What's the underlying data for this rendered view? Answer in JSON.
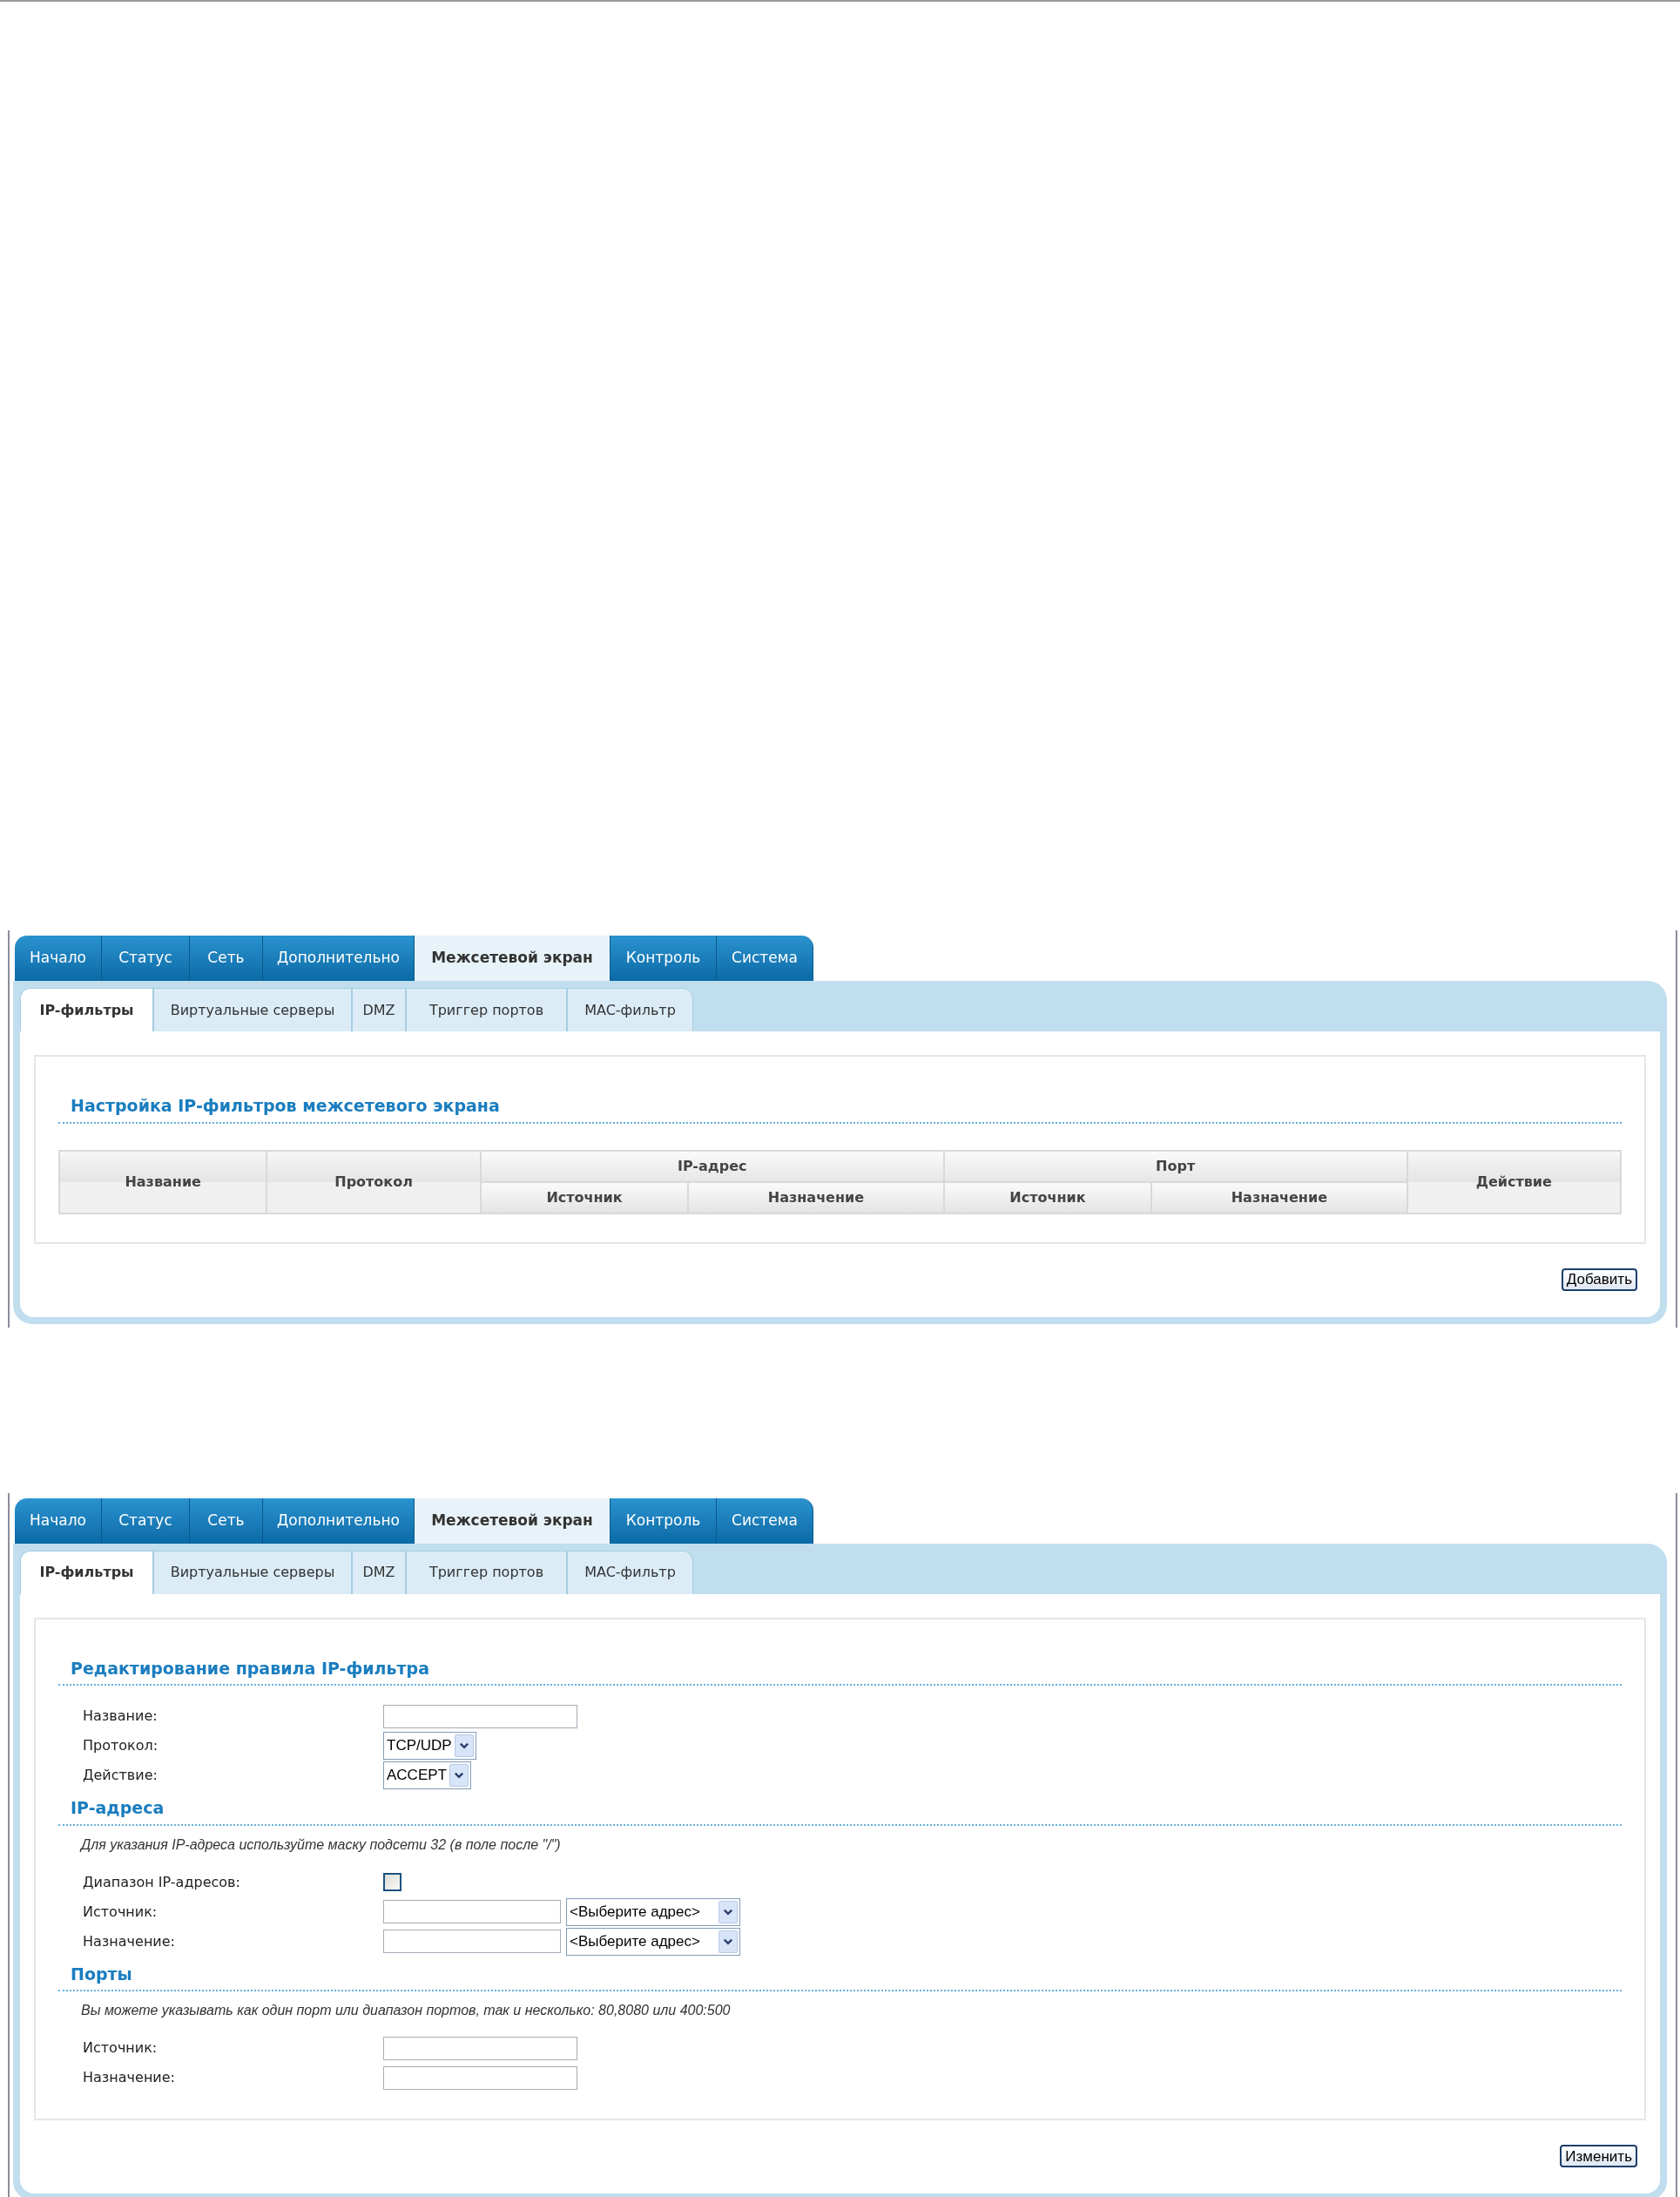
{
  "screens": [
    {
      "kind": "rule_list",
      "tabs": [
        {
          "label": "Начало",
          "selected": false
        },
        {
          "label": "Статус",
          "selected": false
        },
        {
          "label": "Сеть",
          "selected": false
        },
        {
          "label": "Дополнительно",
          "selected": false
        },
        {
          "label": "Межсетевой экран",
          "selected": true
        },
        {
          "label": "Контроль",
          "selected": false
        },
        {
          "label": "Система",
          "selected": false
        }
      ],
      "subtabs": [
        {
          "label": "IP-фильтры",
          "selected": true
        },
        {
          "label": "Виртуальные серверы",
          "selected": false
        },
        {
          "label": "DMZ",
          "selected": false
        },
        {
          "label": "Триггер портов",
          "selected": false
        },
        {
          "label": "MAC-фильтр",
          "selected": false
        }
      ],
      "heading": "Настройка IP-фильтров межсетевого экрана",
      "table": {
        "columns": [
          {
            "label": "Название"
          },
          {
            "label": "Протокол"
          },
          {
            "label": "IP-адрес",
            "children": [
              "Источник",
              "Назначение"
            ]
          },
          {
            "label": "Порт",
            "children": [
              "Источник",
              "Назначение"
            ]
          },
          {
            "label": "Действие"
          }
        ]
      },
      "button": "Добавить"
    },
    {
      "kind": "rule_edit",
      "tabs": [
        {
          "label": "Начало",
          "selected": false
        },
        {
          "label": "Статус",
          "selected": false
        },
        {
          "label": "Сеть",
          "selected": false
        },
        {
          "label": "Дополнительно",
          "selected": false
        },
        {
          "label": "Межсетевой экран",
          "selected": true
        },
        {
          "label": "Контроль",
          "selected": false
        },
        {
          "label": "Система",
          "selected": false
        }
      ],
      "subtabs": [
        {
          "label": "IP-фильтры",
          "selected": true
        },
        {
          "label": "Виртуальные серверы",
          "selected": false
        },
        {
          "label": "DMZ",
          "selected": false
        },
        {
          "label": "Триггер портов",
          "selected": false
        },
        {
          "label": "MAC-фильтр",
          "selected": false
        }
      ],
      "sections": [
        {
          "title": "Редактирование правила IP-фильтра",
          "fields": [
            {
              "label": "Название:",
              "kind": "input"
            },
            {
              "label": "Протокол:",
              "kind": "select",
              "value": "TCP/UDP"
            },
            {
              "label": "Действие:",
              "kind": "select",
              "value": "ACCEPT"
            }
          ]
        },
        {
          "title": "IP-адреса",
          "note": "Для указания IP-адреса используйте маску подсети 32 (в поле после \"/\")",
          "fields": [
            {
              "label": "Диапазон IP-адресов:",
              "kind": "checkbox",
              "checked": false
            },
            {
              "label": "Источник:",
              "kind": "input_select",
              "value": "<Выберите адрес>"
            },
            {
              "label": "Назначение:",
              "kind": "input_select",
              "value": "<Выберите адрес>"
            }
          ]
        },
        {
          "title": "Порты",
          "note": "Вы можете указывать как один порт или диапазон портов, так и несколько: 80,8080 или 400:500",
          "fields": [
            {
              "label": "Источник:",
              "kind": "input"
            },
            {
              "label": "Назначение:",
              "kind": "input"
            }
          ]
        }
      ],
      "button": "Изменить"
    }
  ]
}
